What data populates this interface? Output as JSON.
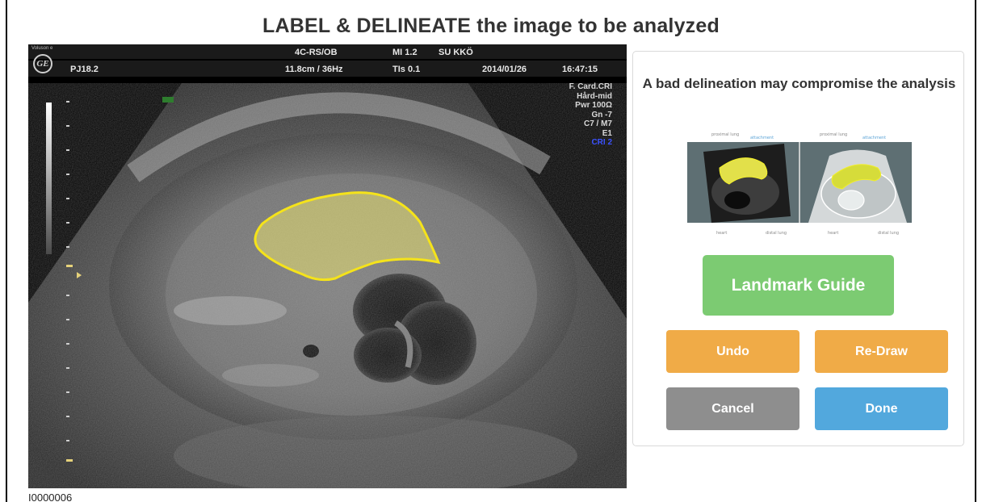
{
  "page": {
    "title": "LABEL & DELINEATE the image to be analyzed",
    "image_id": "I0000006"
  },
  "ultrasound": {
    "brand": "Voluson e",
    "logo_text": "GE",
    "probe": "PJ18.2",
    "mode": "4C-RS/OB",
    "mi": "MI 1.2",
    "operator": "SU KKÖ",
    "depth_freq": "11.8cm / 36Hz",
    "tis": "TIs 0.1",
    "date": "2014/01/26",
    "time": "16:47:15",
    "settings": [
      "F. Card.CRI",
      "Hård-mid",
      "Pwr 100Ω",
      "Gn -7",
      "C7 / M7",
      "E1"
    ],
    "cri": "CRI 2",
    "outline_color": "#f5e31a",
    "fill_color": "#e8e070"
  },
  "panel": {
    "warning": "A bad delineation may compromise the analysis",
    "guide_labels": {
      "left_top": "proximal lung",
      "left_top2": "attachment",
      "left_bottom": "heart",
      "left_bottom2": "distal lung",
      "right_top": "proximal lung",
      "right_top2": "attachment",
      "right_bottom": "heart",
      "right_bottom2": "distal lung"
    },
    "buttons": {
      "landmark": "Landmark Guide",
      "undo": "Undo",
      "redraw": "Re-Draw",
      "cancel": "Cancel",
      "done": "Done"
    },
    "colors": {
      "landmark": "#7ccb72",
      "undo": "#f0ab47",
      "cancel": "#8e8e8e",
      "done": "#52a8dd"
    }
  }
}
